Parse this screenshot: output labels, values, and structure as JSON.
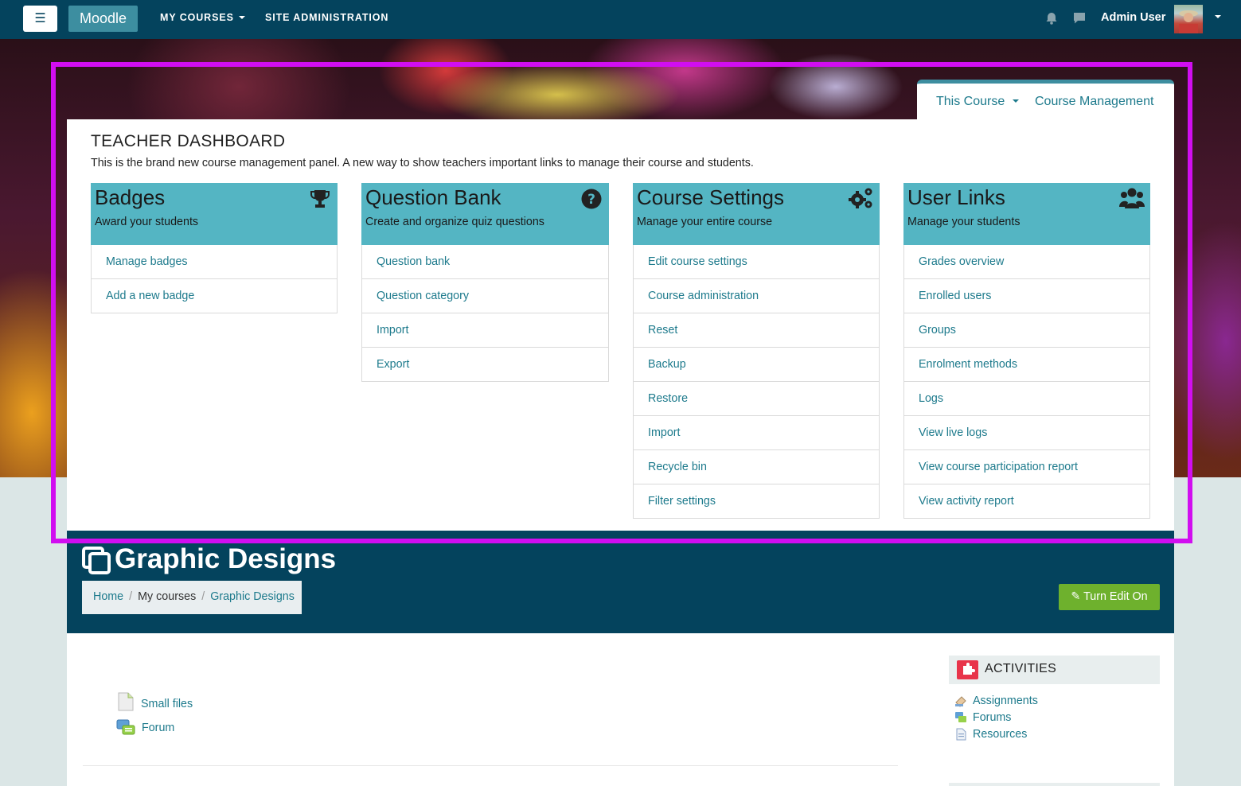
{
  "navbar": {
    "toggle_label": "☰",
    "brand": "Moodle",
    "my_courses": "MY COURSES",
    "site_admin": "SITE ADMINISTRATION",
    "user_name": "Admin User"
  },
  "tabs": {
    "this_course": "This Course",
    "course_management": "Course Management"
  },
  "dashboard": {
    "title": "TEACHER DASHBOARD",
    "description": "This is the brand new course management panel.  A new way to show teachers important links to manage their course and students."
  },
  "cards": [
    {
      "title": "Badges",
      "subtitle": "Award your students",
      "icon": "trophy-icon",
      "links": [
        "Manage badges",
        "Add a new badge"
      ]
    },
    {
      "title": "Question Bank",
      "subtitle": "Create and organize quiz questions",
      "icon": "question-circle-icon",
      "links": [
        "Question bank",
        "Question category",
        "Import",
        "Export"
      ]
    },
    {
      "title": "Course Settings",
      "subtitle": "Manage your entire course",
      "icon": "gears-icon",
      "links": [
        "Edit course settings",
        "Course administration",
        "Reset",
        "Backup",
        "Restore",
        "Import",
        "Recycle bin",
        "Filter settings"
      ]
    },
    {
      "title": "User Links",
      "subtitle": "Manage your students",
      "icon": "users-icon",
      "links": [
        "Grades overview",
        "Enrolled users",
        "Groups",
        "Enrolment methods",
        "Logs",
        "View live logs",
        "View course participation report",
        "View activity report"
      ]
    }
  ],
  "course": {
    "title": "Graphic Designs",
    "breadcrumb": [
      "Home",
      "My courses",
      "Graphic Designs"
    ],
    "edit_button": "Turn Edit On"
  },
  "activities": [
    "Small files",
    "Forum"
  ],
  "side_block": {
    "title": "ACTIVITIES",
    "links": [
      "Assignments",
      "Forums",
      "Resources"
    ]
  },
  "colors": {
    "navbar": "#04435d",
    "card_header": "#54b5c3",
    "link": "#1d7a8c",
    "highlight": "#d10ef0",
    "edit_button": "#6eb12d"
  }
}
